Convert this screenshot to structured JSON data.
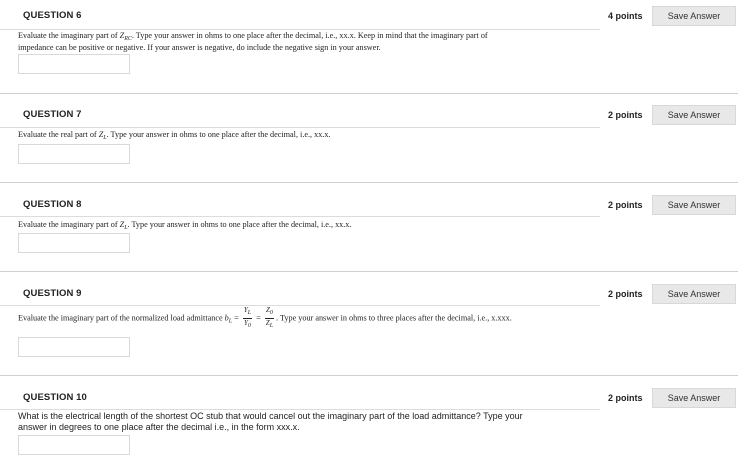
{
  "questions": [
    {
      "title": "QUESTION 6",
      "points": "4 points",
      "save_label": "Save Answer",
      "text_a": "Evaluate the imaginary part of ",
      "sym": "Z",
      "sym_sub": "RC",
      "text_b": ". Type your answer in ohms to one place after the decimal, i.e., xx.x. Keep in mind that the imaginary part of",
      "text_c": "impedance can be positive or negative. If your answer is negative, do include the negative sign in your answer."
    },
    {
      "title": "QUESTION 7",
      "points": "2 points",
      "save_label": "Save Answer",
      "text_a": "Evaluate the real part of ",
      "sym": "Z",
      "sym_sub": "L",
      "text_b": ". Type your answer in ohms to one place after the decimal, i.e., xx.x."
    },
    {
      "title": "QUESTION 8",
      "points": "2 points",
      "save_label": "Save Answer",
      "text_a": "Evaluate the imaginary part of ",
      "sym": "Z",
      "sym_sub": "L",
      "text_b": ". Type your answer in ohms to one place after the decimal, i.e., xx.x."
    },
    {
      "title": "QUESTION 9",
      "points": "2 points",
      "save_label": "Save Answer",
      "text_a": "Evaluate the imaginary part of the normalized load admittance ",
      "sym": "b",
      "sym_sub": "L",
      "eq": "=",
      "frac1_num": "Y",
      "frac1_num_sub": "L",
      "frac1_den": "Y",
      "frac1_den_sub": "0",
      "frac2_num": "Z",
      "frac2_num_sub": "0",
      "frac2_den": "Z",
      "frac2_den_sub": "L",
      "text_b": ". Type your answer in ohms to three places after the decimal, i.e., x.xxx."
    },
    {
      "title": "QUESTION 10",
      "points": "2 points",
      "save_label": "Save Answer",
      "text_a": "What is the electrical length of the shortest OC stub that would cancel out the imaginary part of the load admittance? Type your",
      "text_c": "answer in degrees to one place after the decimal i.e., in the form xxx.x."
    }
  ]
}
